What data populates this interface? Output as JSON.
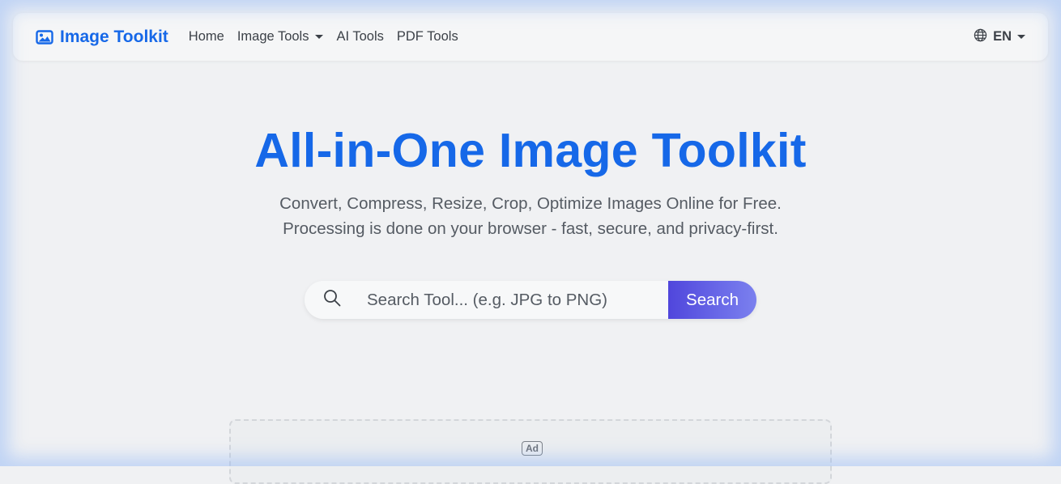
{
  "navbar": {
    "brand": "Image Toolkit",
    "links": [
      {
        "label": "Home",
        "dropdown": false
      },
      {
        "label": "Image Tools",
        "dropdown": true
      },
      {
        "label": "AI Tools",
        "dropdown": false
      },
      {
        "label": "PDF Tools",
        "dropdown": false
      }
    ],
    "language": "EN"
  },
  "hero": {
    "title": "All-in-One Image Toolkit",
    "subtitle_line1": "Convert, Compress, Resize, Crop, Optimize Images Online for Free.",
    "subtitle_line2": "Processing is done on your browser - fast, secure, and privacy-first."
  },
  "search": {
    "placeholder": "Search Tool... (e.g. JPG to PNG)",
    "value": "",
    "button_label": "Search",
    "icon": "search-icon"
  },
  "ad": {
    "badge": "Ad"
  },
  "colors": {
    "brand": "#1668e8",
    "button_start": "#5046dc",
    "button_end": "#7b80ee",
    "text": "#3c4148",
    "background": "#f0f1f3"
  }
}
